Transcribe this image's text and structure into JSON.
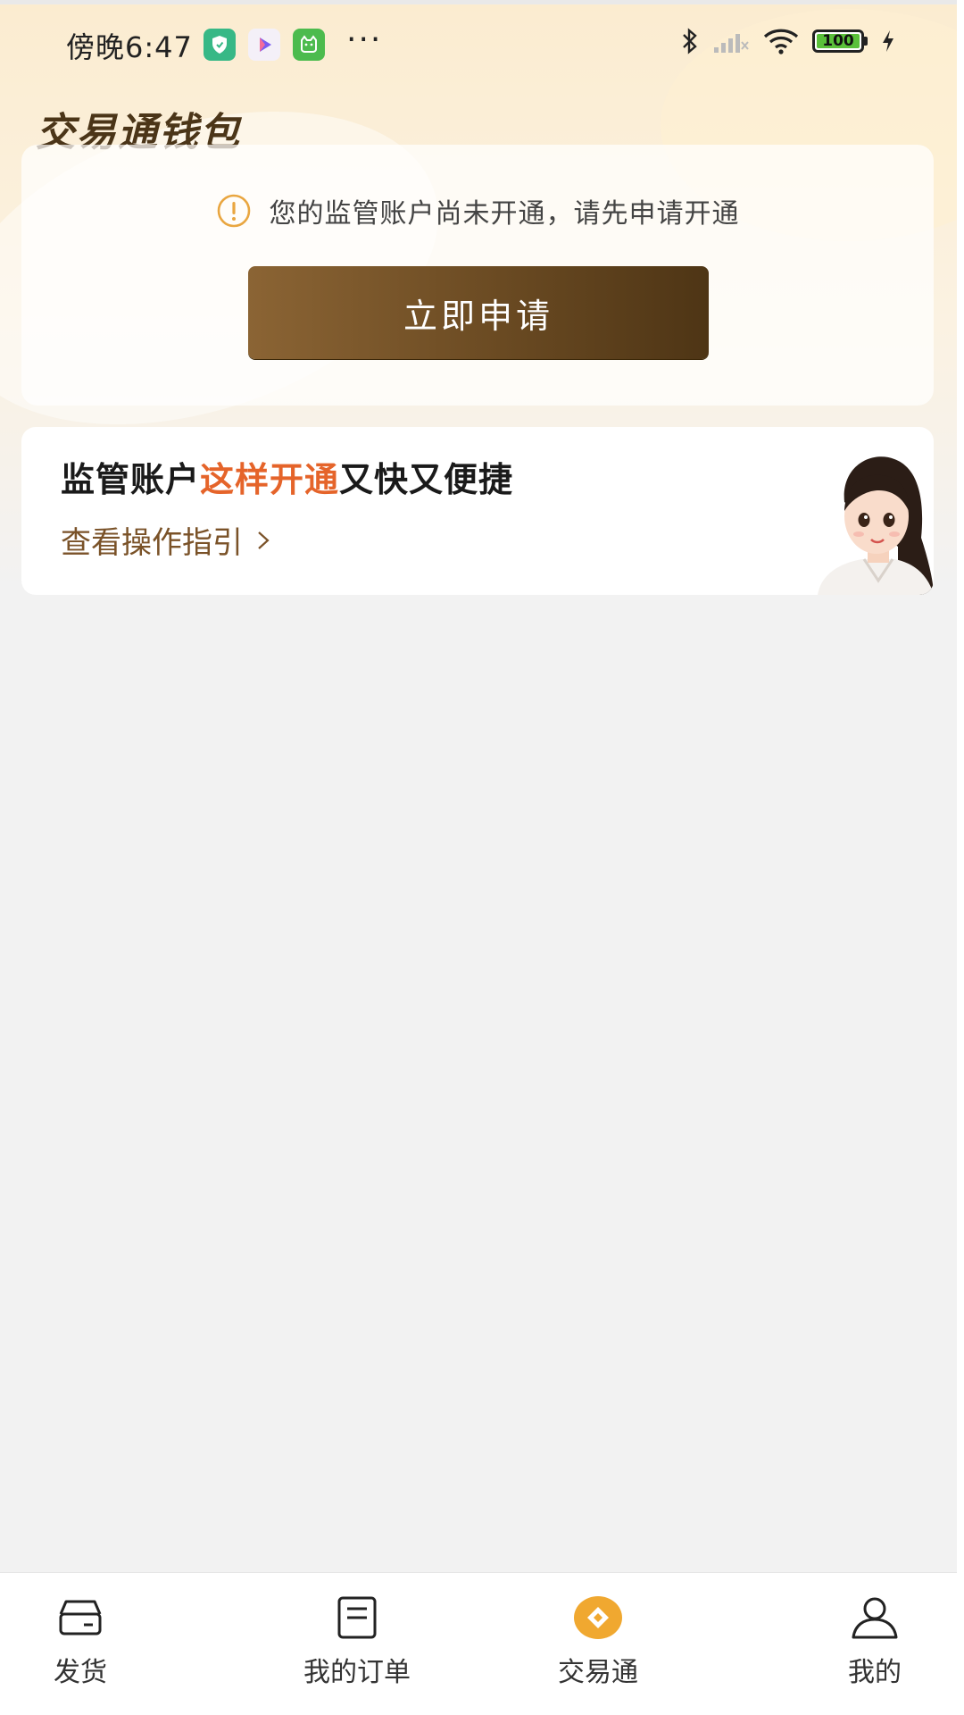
{
  "status_bar": {
    "time": "傍晚6:47",
    "more": "···",
    "battery": "100"
  },
  "page": {
    "title": "交易通钱包"
  },
  "notice": {
    "message": "您的监管账户尚未开通，请先申请开通",
    "apply_label": "立即申请"
  },
  "guide": {
    "title_prefix": "监管账户",
    "title_highlight": "这样开通",
    "title_suffix": "又快又便捷",
    "link_label": "查看操作指引"
  },
  "tabs": [
    {
      "label": "发货",
      "icon": "truck-card-icon",
      "active": false
    },
    {
      "label": "我的订单",
      "icon": "order-list-icon",
      "active": false
    },
    {
      "label": "交易通",
      "icon": "diamond-coin-icon",
      "active": true
    },
    {
      "label": "我的",
      "icon": "user-icon",
      "active": false
    }
  ],
  "colors": {
    "accent_orange": "#e5642a",
    "button_brown": "#6a4a22",
    "active_tab": "#f0a830",
    "link_brown": "#7a5228"
  }
}
